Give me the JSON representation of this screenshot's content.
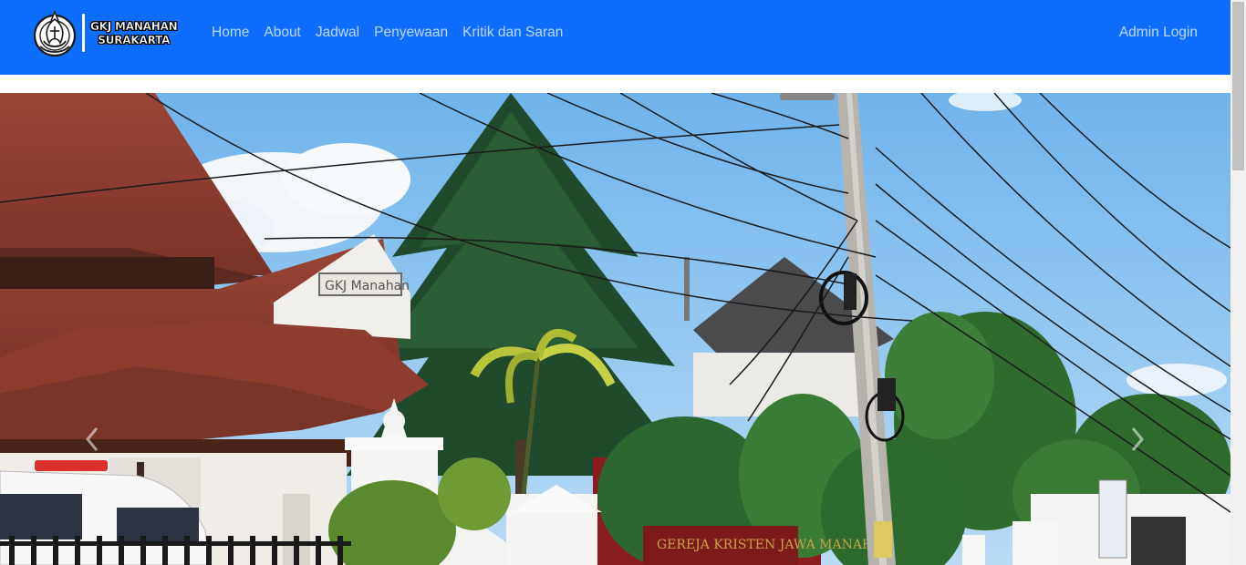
{
  "navbar": {
    "brand": {
      "line1": "GKJ MANAHAN",
      "line2": "SURAKARTA",
      "logo_icon": "church-emblem-icon"
    },
    "links": [
      {
        "label": "Home"
      },
      {
        "label": "About"
      },
      {
        "label": "Jadwal"
      },
      {
        "label": "Penyewaan"
      },
      {
        "label": "Kritik dan Saran"
      }
    ],
    "admin_label": "Admin Login",
    "bg_color": "#0d6efd"
  },
  "hero": {
    "sign_text": "GKJ Manahan",
    "prev_icon": "chevron-left-icon",
    "next_icon": "chevron-right-icon"
  }
}
